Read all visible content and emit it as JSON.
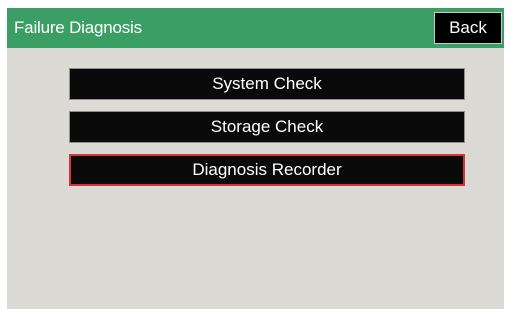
{
  "header": {
    "title": "Failure Diagnosis",
    "back_label": "Back"
  },
  "menu": {
    "items": [
      {
        "label": "System Check",
        "selected": false
      },
      {
        "label": "Storage Check",
        "selected": false
      },
      {
        "label": "Diagnosis Recorder",
        "selected": true
      }
    ]
  },
  "colors": {
    "header_background": "#3b9e64",
    "screen_background": "#dcdad5",
    "button_background": "#0a0a0a",
    "selection_border": "#d6333c"
  }
}
